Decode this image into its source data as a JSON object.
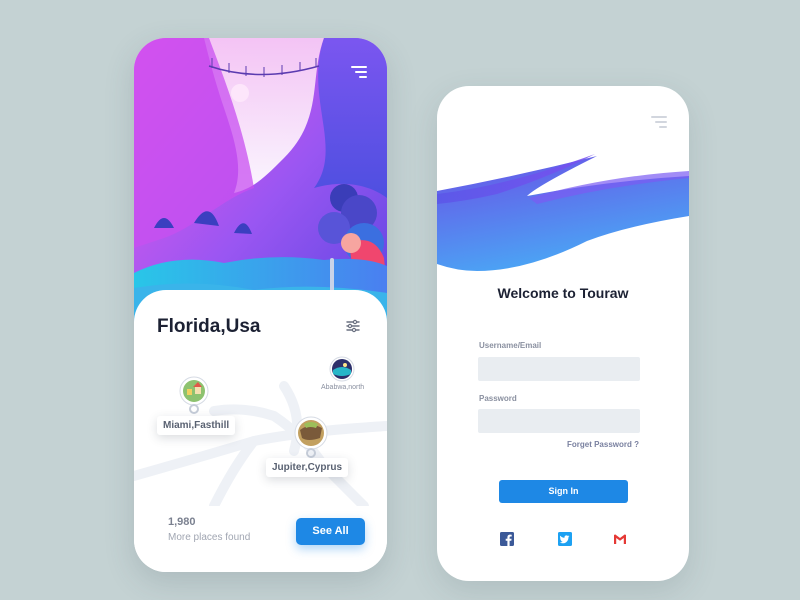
{
  "explore_screen": {
    "place_title": "Florida,Usa",
    "pins": [
      {
        "label": "Miami,Fasthill"
      },
      {
        "label": "Jupiter,Cyprus"
      },
      {
        "label": "Ababwa,north"
      }
    ],
    "places_count": "1,980",
    "places_caption": "More places found",
    "see_all_label": "See All",
    "icons": {
      "menu": "menu-icon",
      "filter": "sliders-icon"
    }
  },
  "login_screen": {
    "title": "Welcome to Touraw",
    "username_label": "Username/Email",
    "username_value": "",
    "password_label": "Password",
    "password_value": "",
    "forget_password_label": "Forget Password ?",
    "sign_in_label": "Sign In",
    "social": [
      {
        "name": "facebook-icon",
        "color": "#3b5998"
      },
      {
        "name": "twitter-icon",
        "color": "#1da1f2"
      },
      {
        "name": "gmail-icon",
        "color": "#e53935"
      }
    ]
  },
  "colors": {
    "accent": "#1e88e5",
    "background": "#c4d2d3",
    "hero_purple": "#7a4df0",
    "hero_pink": "#e65cf0"
  }
}
